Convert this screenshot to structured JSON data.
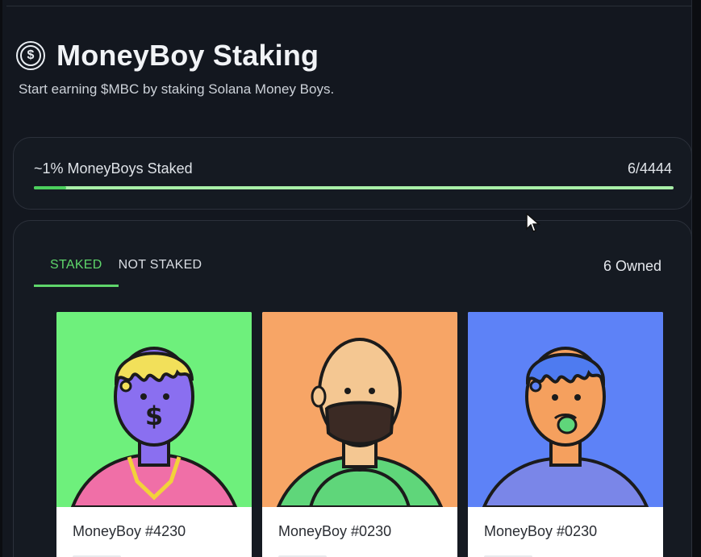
{
  "header": {
    "icon": "dollar-coin-icon",
    "title": "MoneyBoy Staking",
    "subtitle": "Start earning $MBC by staking Solana Money Boys."
  },
  "progress": {
    "label": "~1% MoneyBoys Staked",
    "count": "6/4444",
    "fraction": 0.05,
    "track_color": "#a8efa8",
    "fill_color": "#4ccf5d"
  },
  "tabs": [
    {
      "label": "STAKED",
      "active": true
    },
    {
      "label": "NOT STAKED",
      "active": false
    }
  ],
  "owned_label": "6 Owned",
  "nfts": [
    {
      "name": "MoneyBoy #4230",
      "bg": "#6ef07c",
      "skin": "#8a6ff0",
      "hair": "#f2e05a"
    },
    {
      "name": "MoneyBoy #0230",
      "bg": "#f7a566",
      "skin": "#f4c792",
      "hair": "#3b2a24"
    },
    {
      "name": "MoneyBoy #0230",
      "bg": "#5d82f7",
      "skin": "#f5a05e",
      "hair": "#4e7bf0"
    }
  ],
  "colors": {
    "accent": "#5fd66b",
    "background": "#13171f",
    "card_border": "#2c313b"
  }
}
